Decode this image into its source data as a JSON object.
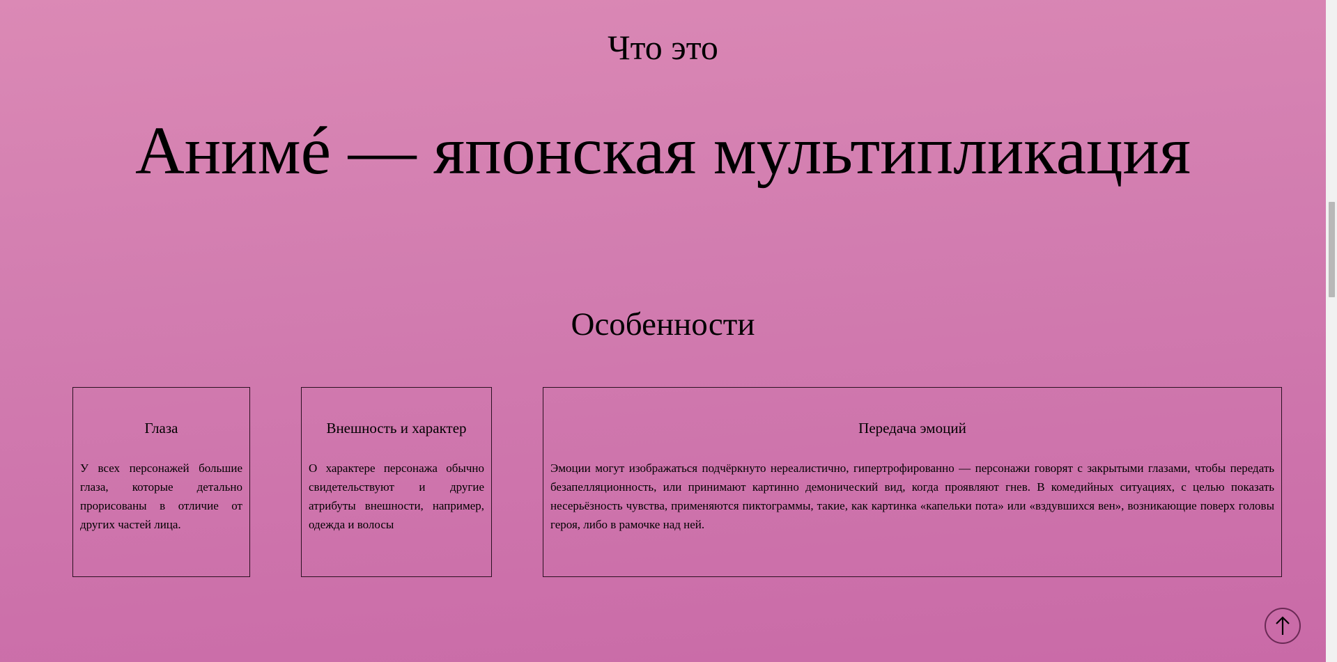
{
  "intro": {
    "kicker": "Что это",
    "headline": "Анимé — японская мультипликация"
  },
  "features": {
    "title": "Особенности",
    "cards": [
      {
        "title": "Глаза",
        "text": "У всех персонажей большие глаза, которые детально прорисованы в отличие от других частей лица."
      },
      {
        "title": "Внешность и характер",
        "text": "О характере персонажа обычно свидетельствуют и другие атрибуты внешности, например, одежда и волосы"
      },
      {
        "title": "Передача эмоций",
        "text": "Эмоции могут изображаться подчёркнуто нереалистично, гипертрофированно — персонажи говорят с закрытыми глазами, чтобы передать безапелляционность, или принимают картинно демонический вид, когда проявляют гнев. В комедийных ситуациях, с целью показать несерьёзность чувства, применяются пиктограммы, такие, как картинка «капельки пота» или «вздувшихся вен», возникающие поверх головы героя, либо в рамочке над ней."
      }
    ]
  },
  "controls": {
    "scroll_top_icon": "arrow-up-icon"
  },
  "colors": {
    "background_top": "#db89b5",
    "background_bottom": "#c96aa7",
    "border": "#2a1020"
  }
}
